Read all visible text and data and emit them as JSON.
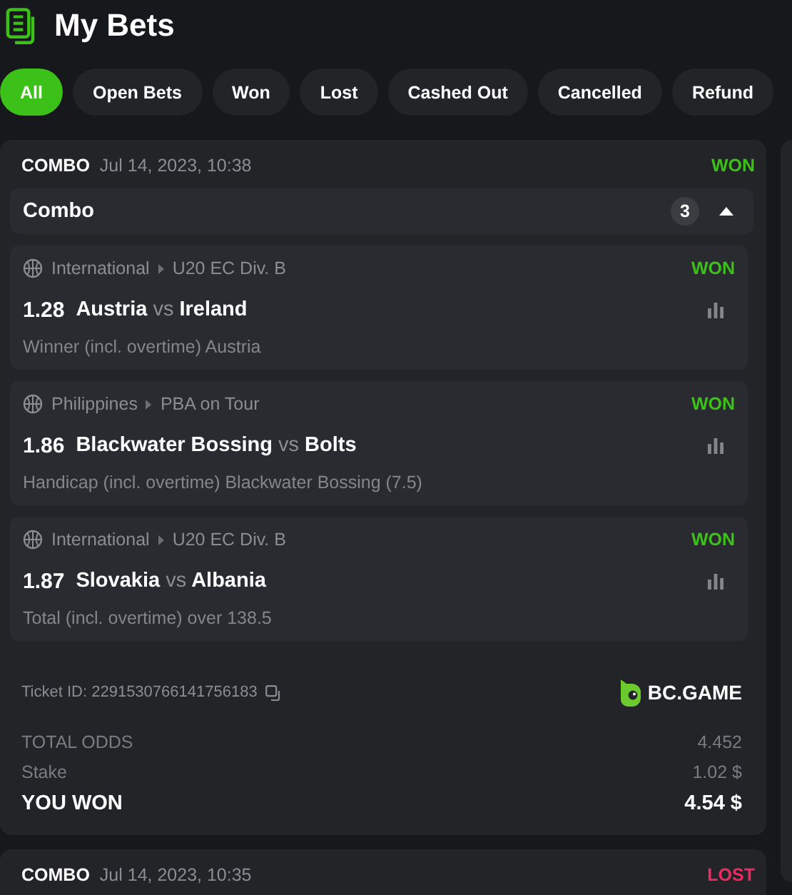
{
  "title": "My Bets",
  "filters": [
    {
      "label": "All",
      "selected": true
    },
    {
      "label": "Open Bets",
      "selected": false
    },
    {
      "label": "Won",
      "selected": false
    },
    {
      "label": "Lost",
      "selected": false
    },
    {
      "label": "Cashed Out",
      "selected": false
    },
    {
      "label": "Cancelled",
      "selected": false
    },
    {
      "label": "Refund",
      "selected": false
    }
  ],
  "bets": [
    {
      "type": "COMBO",
      "date": "Jul 14, 2023, 10:38",
      "status": "WON",
      "color": "#3bc117",
      "group": {
        "label": "Combo",
        "count": "3",
        "expanded": true
      },
      "legs": [
        {
          "category": "International",
          "league": "U20 EC Div. B",
          "status": "WON",
          "color": "#3bc117",
          "odds": "1.28",
          "home": "Austria",
          "vs": "vs",
          "away": "Ireland",
          "market": "Winner (incl. overtime) Austria"
        },
        {
          "category": "Philippines",
          "league": "PBA on Tour",
          "status": "WON",
          "color": "#3bc117",
          "odds": "1.86",
          "home": "Blackwater Bossing",
          "vs": "vs",
          "away": "Bolts",
          "market": "Handicap (incl. overtime) Blackwater Bossing (7.5)"
        },
        {
          "category": "International",
          "league": "U20 EC Div. B",
          "status": "WON",
          "color": "#3bc117",
          "odds": "1.87",
          "home": "Slovakia",
          "vs": "vs",
          "away": "Albania",
          "market": "Total (incl. overtime) over 138.5"
        }
      ],
      "ticket_id": "Ticket ID: 2291530766141756183",
      "brand": "BC.GAME",
      "totals": [
        {
          "kind": "odds",
          "label": "TOTAL ODDS",
          "value": "4.452"
        },
        {
          "kind": "stake",
          "label": "Stake",
          "value": "1.02 $"
        },
        {
          "kind": "payout",
          "label": "YOU WON",
          "value": "4.54 $"
        }
      ]
    },
    {
      "type": "COMBO",
      "date": "Jul 14, 2023, 10:35",
      "status": "LOST",
      "color": "#ed2b63"
    }
  ]
}
